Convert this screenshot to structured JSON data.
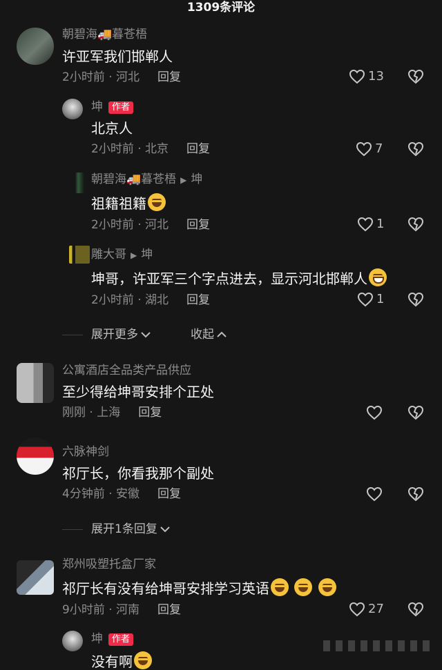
{
  "header": {
    "title": "1309条评论"
  },
  "comments": [
    {
      "user": "朝碧海🚚暮苍梧",
      "text": "许亚军我们邯郸人",
      "time": "2小时前 · 河北",
      "reply": "回复",
      "likes": "13"
    },
    {
      "user": "坤",
      "badge": "作者",
      "text": "北京人",
      "time": "2小时前 · 北京",
      "reply": "回复",
      "likes": "7"
    },
    {
      "user": "朝碧海🚚暮苍梧",
      "reply_to": "坤",
      "text": "祖籍祖籍",
      "time": "2小时前 · 河北",
      "reply": "回复",
      "likes": "1"
    },
    {
      "user": "雕大哥",
      "reply_to": "坤",
      "text": "坤哥，许亚军三个字点进去，显示河北邯郸人",
      "time": "2小时前 · 湖北",
      "reply": "回复",
      "likes": "1"
    },
    {
      "user": "公寓酒店全品类产品供应",
      "text": "至少得给坤哥安排个正处",
      "time": "刚刚 · 上海",
      "reply": "回复",
      "likes": ""
    },
    {
      "user": "六脉神剑",
      "text": "祁厅长，你看我那个副处",
      "time": "4分钟前 · 安徽",
      "reply": "回复",
      "likes": ""
    },
    {
      "user": "郑州吸塑托盒厂家",
      "text": "祁厅长有没有给坤哥安排学习英语",
      "time": "9小时前 · 河南",
      "reply": "回复",
      "likes": "27"
    },
    {
      "user": "坤",
      "badge": "作者",
      "text": "没有啊",
      "time": "",
      "reply": "",
      "likes": ""
    }
  ],
  "thread1": {
    "expand_more": "展开更多",
    "collapse": "收起"
  },
  "thread2": {
    "expand": "展开1条回复"
  },
  "colors": {
    "background": "#161616",
    "badge": "#ee2c4a",
    "muted": "#8c8c8c"
  }
}
